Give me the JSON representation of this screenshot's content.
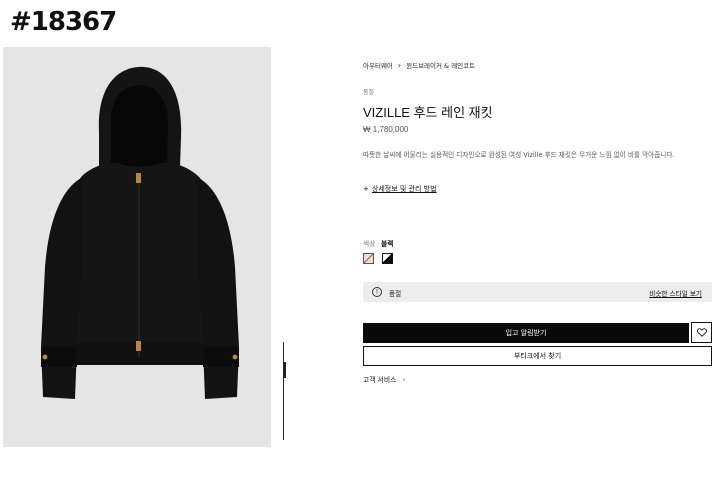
{
  "watermark": "#18367",
  "product": {
    "breadcrumb": [
      "아우터웨어",
      "윈드브레이커 & 레인코트"
    ],
    "category": "품절",
    "title": "VIZILLE 후드 레인 재킷",
    "price": "₩ 1,780,000",
    "description": "따뜻한 날씨에 어울리는 실용적인 디자인으로 완성된 여성 Vizille 후드 재킷은 무거운 느낌 없이 비를 막아줍니다.",
    "details_link": "상세정보 및 관리 방법",
    "details_prefix": "+",
    "color_label": "색상",
    "color_value": "블랙",
    "notice_text": "품절",
    "notice_link": "비슷한 스타일 보기",
    "primary_button": "입고 알림받기",
    "secondary_button": "부티크에서 찾기",
    "customer_service": "고객 서비스"
  },
  "colors": {
    "accent": "#0a0a0a",
    "notice_bg": "#ededed",
    "gallery_bg": "#e5e5e5"
  },
  "icons": {
    "info": "info-icon",
    "heart": "heart-icon",
    "chevron": "chevron-right-icon"
  }
}
